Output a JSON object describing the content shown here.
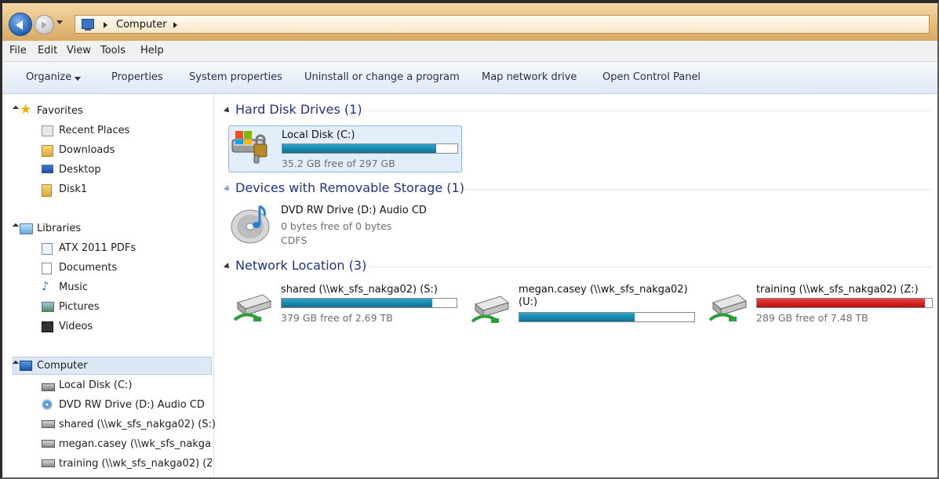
{
  "address_bar": {
    "path": "Computer",
    "back_button": "back-arrow-icon",
    "forward_button": "forward-arrow-icon"
  },
  "menu": [
    "File",
    "Edit",
    "View",
    "Tools",
    "Help"
  ],
  "commands": {
    "organize": "Organize",
    "items": [
      "Properties",
      "System properties",
      "Uninstall or change a program",
      "Map network drive",
      "Open Control Panel"
    ]
  },
  "nav": {
    "favorites": {
      "label": "Favorites",
      "items": [
        "Recent Places",
        "Downloads",
        "Desktop",
        "Disk1"
      ]
    },
    "libraries": {
      "label": "Libraries",
      "items": [
        "ATX 2011 PDFs",
        "Documents",
        "Music",
        "Pictures",
        "Videos"
      ]
    },
    "computer": {
      "label": "Computer",
      "items": [
        "Local Disk (C:)",
        "DVD RW Drive (D:) Audio CD",
        "shared (\\\\wk_sfs_nakga02) (S:)",
        "megan.casey (\\\\wk_sfs_nakga02) (U:)",
        "training (\\\\wk_sfs_nakga02) (Z:)"
      ]
    }
  },
  "groups": {
    "hdd": "Hard Disk Drives (1)",
    "removable": "Devices with Removable Storage (1)",
    "network": "Network Location (3)"
  },
  "drives": {
    "local": {
      "name": "Local Disk (C:)",
      "free": "35.2 GB free of 297 GB",
      "used_fraction": 0.88,
      "color": "#1a8fb8"
    },
    "dvd": {
      "name": "DVD RW Drive (D:) Audio CD",
      "free": "0 bytes free of 0 bytes",
      "fs": "CDFS"
    },
    "shared": {
      "name": "shared (\\\\wk_sfs_nakga02) (S:)",
      "free": "379 GB free of 2.69 TB",
      "used_fraction": 0.86,
      "color": "#1a8fb8"
    },
    "megan": {
      "name_line1": "megan.casey (\\\\wk_sfs_nakga02)",
      "name_line2": "(U:)",
      "used_fraction": 0.66,
      "color": "#1a8fb8"
    },
    "training": {
      "name": "training (\\\\wk_sfs_nakga02) (Z:)",
      "free": "289 GB free of 7.48 TB",
      "used_fraction": 0.96,
      "color": "#d62020"
    }
  }
}
